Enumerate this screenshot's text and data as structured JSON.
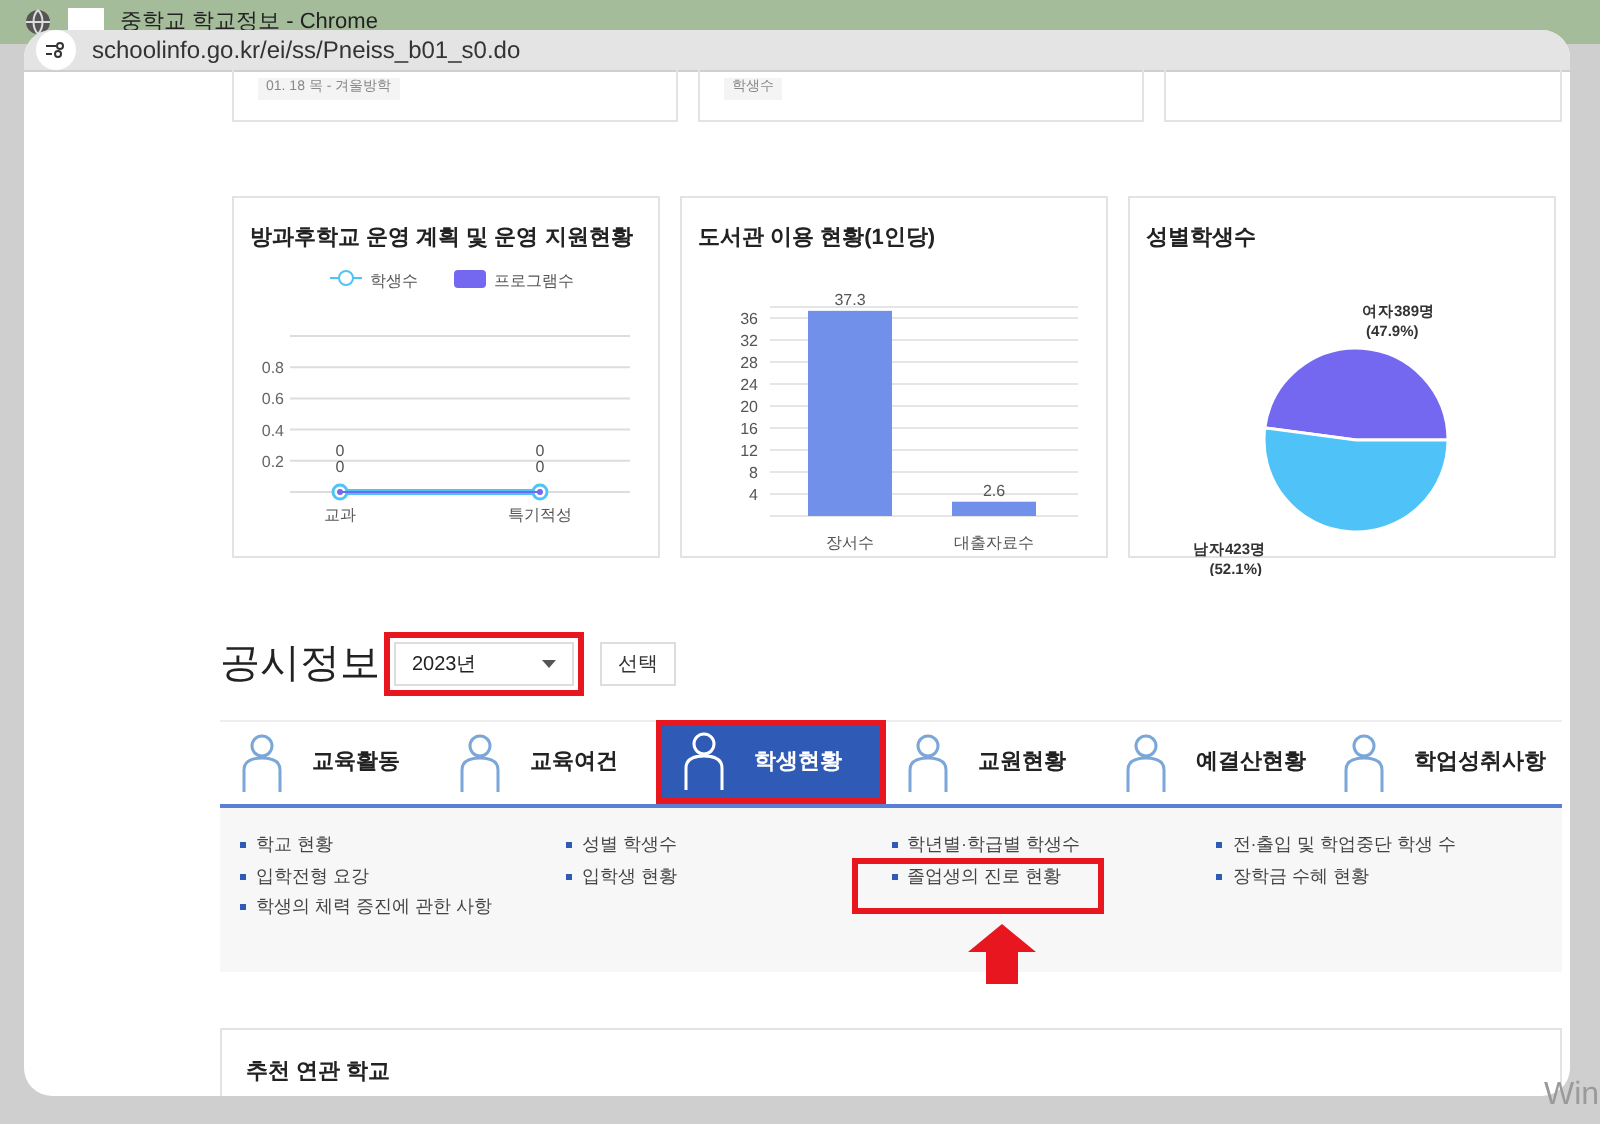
{
  "window": {
    "title": "중학교 학교정보 - Chrome",
    "url": "schoolinfo.go.kr/ei/ss/Pneiss_b01_s0.do"
  },
  "top_cards": [
    {
      "text": "01. 18 목 - 겨울방학"
    },
    {
      "text": "학생수"
    }
  ],
  "charts": [
    {
      "title": "방과후학교 운영 계획 및 운영 지원현황",
      "chart_data": {
        "type": "line",
        "categories": [
          "교과",
          "특기적성"
        ],
        "legend": "top",
        "series": [
          {
            "name": "학생수",
            "color": "#4fc3f7",
            "values": [
              0,
              0
            ],
            "marker": "circle"
          },
          {
            "name": "프로그램수",
            "color": "#7568f0",
            "values": [
              0,
              0
            ],
            "marker": "circle"
          }
        ],
        "yticks": [
          0.2,
          0.4,
          0.6,
          0.8
        ],
        "ylim": [
          0,
          1
        ],
        "grid": true,
        "value_labels": [
          "0",
          "0"
        ]
      }
    },
    {
      "title": "도서관 이용 현황(1인당)",
      "chart_data": {
        "type": "bar",
        "categories": [
          "장서수",
          "대출자료수"
        ],
        "values": [
          37.3,
          2.6
        ],
        "yticks": [
          4,
          8,
          12,
          16,
          20,
          24,
          28,
          32,
          36
        ],
        "ylim": [
          0,
          38
        ],
        "grid": true,
        "value_labels": [
          "37.3",
          "2.6"
        ],
        "color": "#7090ea"
      }
    },
    {
      "title": "성별학생수",
      "chart_data": {
        "type": "pie",
        "categories": [
          "여자389명",
          "남자423명"
        ],
        "values": [
          47.9,
          52.1
        ],
        "value_labels": [
          "(47.9%)",
          "(52.1%)"
        ],
        "colors": [
          "#7568f0",
          "#4fc3f7"
        ]
      }
    }
  ],
  "disclosure": {
    "heading": "공시정보",
    "year_select": {
      "value": "2023년",
      "highlighted": true
    },
    "button": "선택"
  },
  "tabs": [
    {
      "label": "교육활동",
      "selected": false,
      "highlighted": false
    },
    {
      "label": "교육여건",
      "selected": false,
      "highlighted": false
    },
    {
      "label": "학생현황",
      "selected": true,
      "highlighted": true
    },
    {
      "label": "교원현황",
      "selected": false,
      "highlighted": false
    },
    {
      "label": "예결산현황",
      "selected": false,
      "highlighted": false
    },
    {
      "label": "학업성취사항",
      "selected": false,
      "highlighted": false
    }
  ],
  "link_columns": [
    [
      {
        "label": "학교 현황",
        "highlighted": false
      },
      {
        "label": "입학전형 요강",
        "highlighted": false
      },
      {
        "label": "학생의 체력 증진에 관한 사항",
        "highlighted": false
      }
    ],
    [
      {
        "label": "성별 학생수",
        "highlighted": false
      },
      {
        "label": "입학생 현황",
        "highlighted": false
      }
    ],
    [
      {
        "label": "학년별·학급별 학생수",
        "highlighted": false
      },
      {
        "label": "졸업생의 진로 현황",
        "highlighted": true
      }
    ],
    [
      {
        "label": "전·출입 및 학업중단 학생 수",
        "highlighted": false
      },
      {
        "label": "장학금 수혜 현황",
        "highlighted": false
      }
    ]
  ],
  "related": {
    "title": "추천 연관 학교"
  },
  "desktop_text": "Win"
}
